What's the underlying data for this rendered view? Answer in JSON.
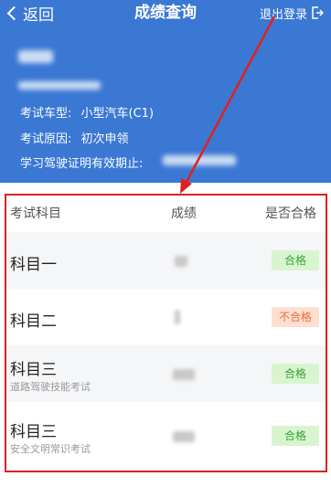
{
  "nav": {
    "back_label": "返回",
    "title": "成绩查询",
    "logout_label": "退出登录"
  },
  "profile": {
    "car_type_label": "考试车型:",
    "car_type_value": "小型汽车(C1)",
    "reason_label": "考试原因:",
    "reason_value": "初次申领",
    "permit_label": "学习驾驶证明有效期止:"
  },
  "table": {
    "headers": [
      "考试科目",
      "成绩",
      "是否合格"
    ],
    "rows": [
      {
        "subject": "科目一",
        "note": "",
        "result": "合格",
        "passed": true
      },
      {
        "subject": "科目二",
        "note": "",
        "result": "不合格",
        "passed": false
      },
      {
        "subject": "科目三",
        "note": "道路驾驶技能考试",
        "result": "合格",
        "passed": true
      },
      {
        "subject": "科目三",
        "note": "安全文明常识考试",
        "result": "合格",
        "passed": true
      }
    ]
  },
  "colors": {
    "header_bg": "#3a78d4",
    "highlight": "#e02020",
    "pass": "#3aa335",
    "fail": "#f26a3a"
  }
}
